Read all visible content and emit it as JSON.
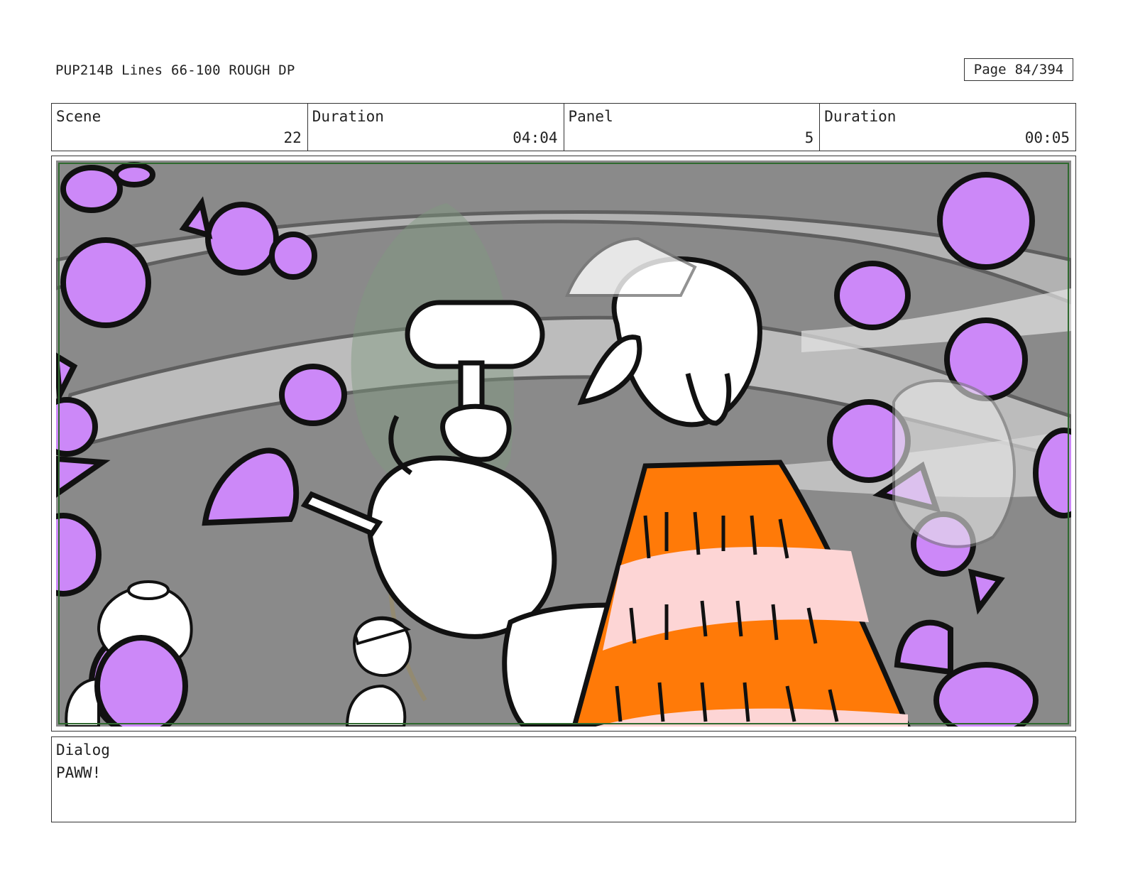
{
  "header": {
    "title": "PUP214B Lines 66-100 ROUGH DP",
    "page_label": "Page",
    "page_value": "84/394"
  },
  "info": {
    "scene_label": "Scene",
    "scene_value": "22",
    "duration_label": "Duration",
    "duration_value": "04:04",
    "panel_label": "Panel",
    "panel_value": "5",
    "panel_duration_label": "Duration",
    "panel_duration_value": "00:05"
  },
  "dialog": {
    "label": "Dialog",
    "text": "PAWW!"
  },
  "colors": {
    "candy_purple": "#cc88f8",
    "cone_orange": "#ff7a08",
    "cone_pink": "#fdd5d5",
    "background_gray": "#8a8a8a",
    "panel_border_green": "#2f6a2f"
  }
}
